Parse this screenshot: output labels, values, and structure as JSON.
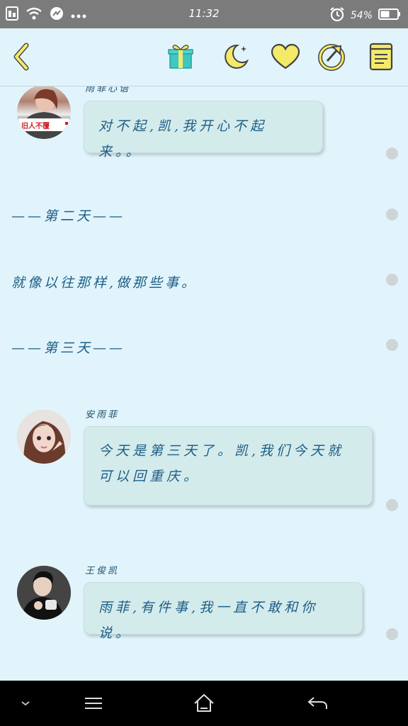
{
  "status_bar": {
    "time": "11:32",
    "battery": "54%",
    "left_icons": [
      "sim-icon",
      "wifi-icon",
      "notification-icon",
      "more-icon"
    ],
    "right_icons": [
      "alarm-icon",
      "battery-icon"
    ]
  },
  "toolbar": {
    "icons": [
      "back-icon",
      "gift-icon",
      "moon-icon",
      "heart-icon",
      "share-icon",
      "book-icon"
    ],
    "accent": "#f4ea6a",
    "gift_color": "#3fc7c2"
  },
  "chat": {
    "msg1": {
      "name": "雨菲心语",
      "text": "对不起,凯,我开心不起来。。",
      "avatar_caption": "旧人不覆"
    },
    "divider2": "——第二天——",
    "narration": "就像以往那样,做那些事。",
    "divider3": "——第三天——",
    "msg2": {
      "name": "安雨菲",
      "line1": "今天是第三天了。凯,我们今天就",
      "line2": "可以回重庆。"
    },
    "msg3": {
      "name": "王俊凯",
      "text": "雨菲,有件事,我一直不敢和你说。"
    }
  },
  "navbar": {
    "icons": [
      "collapse-icon",
      "menu-icon",
      "home-icon",
      "nav-back-icon"
    ]
  }
}
